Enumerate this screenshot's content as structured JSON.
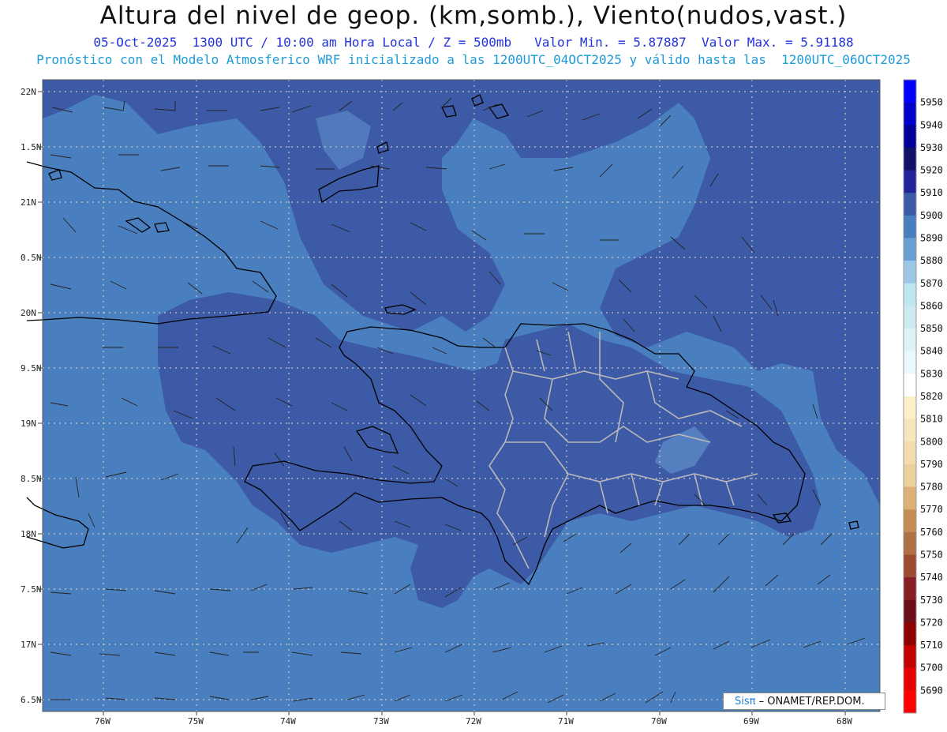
{
  "header": {
    "title": "Altura del nivel de geop. (km,somb.), Viento(nudos,vast.)",
    "subtitle_line1": "05-Oct-2025  1300 UTC / 10:00 am Hora Local / Z = 500mb   Valor Min. = 5.87887  Valor Max. = 5.91188",
    "subtitle_line2": "Pronóstico con el Modelo Atmosferico WRF inicializado a las 1200UTC_04OCT2025 y válido hasta las  1200UTC_06OCT2025"
  },
  "map": {
    "lat_labels": [
      "22N",
      "1.5N",
      "21N",
      "0.5N",
      "20N",
      "9.5N",
      "19N",
      "8.5N",
      "18N",
      "7.5N",
      "17N",
      "6.5N"
    ],
    "lon_labels": [
      "76W",
      "75W",
      "74W",
      "73W",
      "72W",
      "71W",
      "70W",
      "69W",
      "68W"
    ],
    "colors": {
      "band_5890": "#4a7fbf",
      "band_5900": "#3d5aa6",
      "band_5880": "#6a9fd4",
      "coast": "#000000",
      "provinces": "#b8b8b8",
      "grid": "#c8c8c8"
    }
  },
  "colorbar": {
    "levels": [
      "5950",
      "5940",
      "5930",
      "5920",
      "5910",
      "5900",
      "5890",
      "5880",
      "5870",
      "5860",
      "5850",
      "5840",
      "5830",
      "5820",
      "5810",
      "5800",
      "5790",
      "5780",
      "5770",
      "5760",
      "5750",
      "5740",
      "5730",
      "5720",
      "5710",
      "5700",
      "5690"
    ],
    "colors": [
      "#0000ff",
      "#0000cc",
      "#000099",
      "#111166",
      "#24239a",
      "#3d5aa6",
      "#4a7fbf",
      "#6a9fd4",
      "#9cc8e6",
      "#c0e6ef",
      "#cfe9f1",
      "#def3f6",
      "#e9f8f9",
      "#ffffff",
      "#fbf0c6",
      "#f7e6bb",
      "#f0dcad",
      "#ead09a",
      "#ddb279",
      "#c58e56",
      "#b07045",
      "#9c4c34",
      "#871f26",
      "#6d0f16",
      "#8e0000",
      "#c30000",
      "#e60000",
      "#ff0000"
    ]
  },
  "credit": {
    "brand": "Sisπ",
    "text": " – ONAMET/REP.DOM."
  }
}
